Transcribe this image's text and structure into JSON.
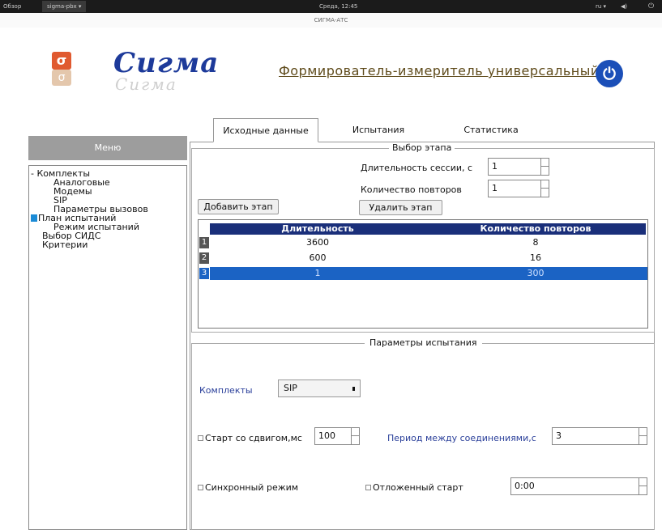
{
  "topbar": {
    "activities": "Обзор",
    "app": "sigma-pbx ▾",
    "clock": "Среда, 12:45",
    "lang": "ru ▾",
    "volume": "◀)",
    "power": "⏻"
  },
  "window": {
    "title": "СИГМА-АТС"
  },
  "header": {
    "logo_text": "Сигма",
    "logo_reflection": "Сигма",
    "logo_glyph": "σ",
    "subtitle": "Формирователь-измеритель универсальный",
    "power_glyph": "⏻"
  },
  "menu": {
    "title": "Меню",
    "items": [
      {
        "label": "- Комплекты"
      },
      {
        "label": "Аналоговые"
      },
      {
        "label": "Модемы"
      },
      {
        "label": "SIP"
      },
      {
        "label": "Параметры вызовов"
      },
      {
        "label": "План испытаний"
      },
      {
        "label": "Режим испытаний"
      },
      {
        "label": "Выбор СИДС"
      },
      {
        "label": "Критерии"
      }
    ]
  },
  "tabs": [
    "Исходные данные",
    "Испытания",
    "Статистика"
  ],
  "stage": {
    "title": "Выбор этапа",
    "duration_label": "Длительность сессии, с",
    "duration_value": "1",
    "repeats_label": "Количество повторов",
    "repeats_value": "1",
    "add_button": "Добавить этап",
    "delete_button": "Удалить этап"
  },
  "table": {
    "columns": [
      "Длительность",
      "Количество повторов"
    ],
    "rows": [
      {
        "idx": "1",
        "duration": "3600",
        "repeats": "8"
      },
      {
        "idx": "2",
        "duration": "600",
        "repeats": "16"
      },
      {
        "idx": "3",
        "duration": "1",
        "repeats": "300"
      }
    ],
    "selected_index": 3
  },
  "test_params": {
    "title": "Параметры испытания",
    "kits_label": "Комплекты",
    "kits_value": "SIP",
    "shift_label": "Старт со сдвигом,мс",
    "shift_value": "100",
    "period_label": "Период между соединениями,с",
    "period_value": "3",
    "sync_label": "Синхронный режим",
    "delayed_label": "Отложенный старт",
    "delayed_value": "0:00"
  },
  "colors": {
    "header_blue": "#1a2f7a",
    "selection_blue": "#1b63c4",
    "logo_blue": "#1d3a9a",
    "logo_orange": "#e05a30"
  }
}
